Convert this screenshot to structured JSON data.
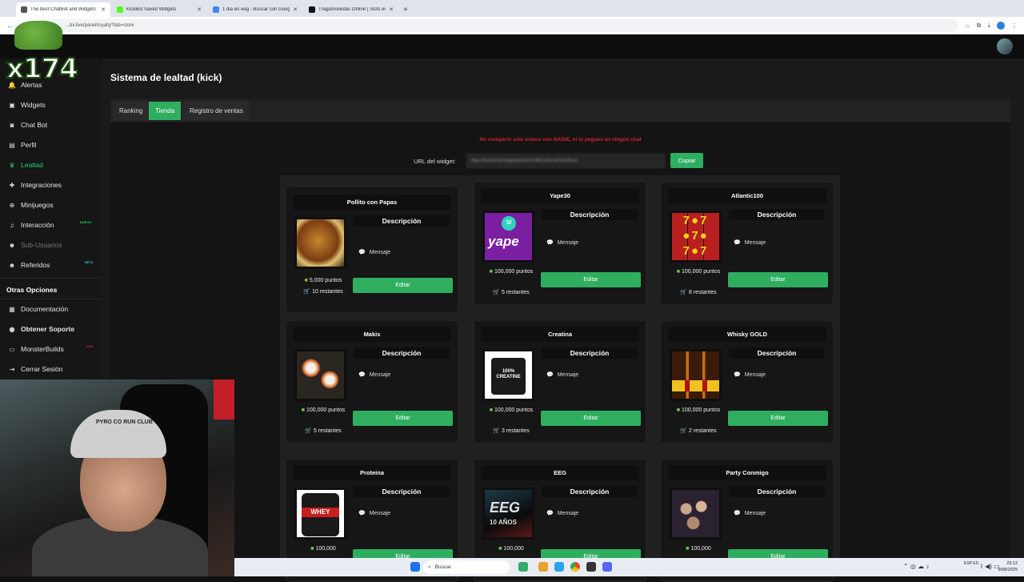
{
  "browser": {
    "tabs": [
      {
        "title": "The best ChatBot and Widgets",
        "active": true
      },
      {
        "title": "KickBot Saved Widgets",
        "active": false
      },
      {
        "title": "1 dia en eeg - Buscar con Goog",
        "active": false
      },
      {
        "title": "Tragamonedas Online | Slots en",
        "active": false
      }
    ],
    "url": "...bx.live/panel/loyalty?tab=store"
  },
  "logo": {
    "text": "x174"
  },
  "sidebar": {
    "items": [
      {
        "label": "Alertas",
        "icon": "bell-icon"
      },
      {
        "label": "Widgets",
        "icon": "widgets-icon"
      },
      {
        "label": "Chat Bot",
        "icon": "robot-icon"
      },
      {
        "label": "Perfil",
        "icon": "id-card-icon"
      },
      {
        "label": "Lealtad",
        "icon": "trophy-icon",
        "active": true
      },
      {
        "label": "Integraciones",
        "icon": "puzzle-icon"
      },
      {
        "label": "Minijuegos",
        "icon": "gamepad-icon"
      },
      {
        "label": "Interacción",
        "icon": "music-icon",
        "badge": "NUEVO"
      },
      {
        "label": "Sub-Usuarios",
        "icon": "users-icon",
        "disabled": true
      },
      {
        "label": "Referidos",
        "icon": "users-icon",
        "badge": "BETA"
      }
    ],
    "section_title": "Otras Opciones",
    "other": [
      {
        "label": "Documentación",
        "icon": "book-icon"
      },
      {
        "label": "Obtener Soporte",
        "icon": "support-icon"
      },
      {
        "label": "MonsterBuilds",
        "icon": "monitor-icon",
        "badge": "ADS"
      },
      {
        "label": "Cerrar Sesión",
        "icon": "logout-icon"
      }
    ]
  },
  "page": {
    "title": "Sistema de lealtad (kick)",
    "tabs": [
      "Ranking",
      "Tienda",
      "Registro de ventas"
    ],
    "active_tab": "Tienda",
    "warning": "No compartir este enlace con NADIE, ni lo pegues en ningún chat",
    "url_label": "URL del widget:",
    "url_value": "https://kickbot.live/widgets/shop?id=3f8c2a91e4d7b6c05a1e",
    "copy_label": "Copiar"
  },
  "store": {
    "description_label": "Descripción",
    "message_label": "Mensaje",
    "edit_label": "Editar",
    "items": [
      {
        "name": "Pollito con Papas",
        "points": "5,000 puntos",
        "remaining": "10 restantes",
        "image": "chicken"
      },
      {
        "name": "Yape30",
        "points": "100,000 puntos",
        "remaining": "5 restantes",
        "image": "yape"
      },
      {
        "name": "Atlantic100",
        "points": "100,000 puntos",
        "remaining": "8 restantes",
        "image": "slots"
      },
      {
        "name": "Makis",
        "points": "100,000 puntos",
        "remaining": "5 restantes",
        "image": "sushi"
      },
      {
        "name": "Creatina",
        "points": "100,000 puntos",
        "remaining": "3 restantes",
        "image": "creatine"
      },
      {
        "name": "Whisky GOLD",
        "points": "100,000 puntos",
        "remaining": "2 restantes",
        "image": "whisky"
      },
      {
        "name": "Proteina",
        "points": "100,000",
        "remaining": "",
        "image": "whey"
      },
      {
        "name": "EEG",
        "points": "100,000",
        "remaining": "",
        "image": "eeg"
      },
      {
        "name": "Party Conmigo",
        "points": "100,000",
        "remaining": "",
        "image": "party"
      }
    ]
  },
  "image_text": {
    "yape_symbol": "S/",
    "yape_word": "yape",
    "creatine_text": "100% CREATINE",
    "whey_text": "WHEY",
    "eeg_text": "EEG",
    "eeg_sub": "10 AÑOS"
  },
  "webcam": {
    "cap_text": "PYRO CO RUN CLUB"
  },
  "taskbar": {
    "search_placeholder": "Buscar",
    "lang": "ESP ES",
    "time": "23:12",
    "date": "9/08/2025"
  }
}
